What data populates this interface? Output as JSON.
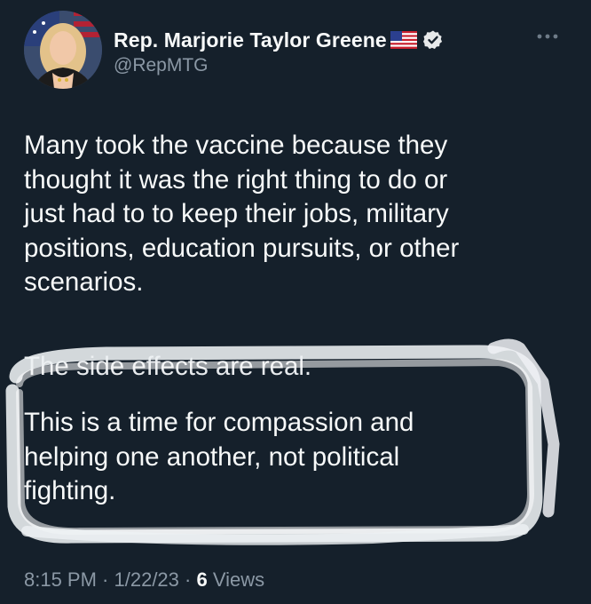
{
  "author": {
    "display_name": "Rep. Marjorie Taylor Greene",
    "flag_icon": "us-flag-icon",
    "verified_icon": "verified-badge-icon",
    "handle": "@RepMTG"
  },
  "menu": {
    "icon": "more-options-icon"
  },
  "tweet": {
    "paragraphs": [
      "Many took the vaccine because they thought it was the right thing to do or just had to to keep their jobs, military positions, education pursuits, or other scenarios.",
      "The side effects are real.",
      "This is a time for compassion and helping one another, not political fighting."
    ],
    "line_breaks": {
      "para_1": [
        "Many took the vaccine because they",
        "thought it was the right thing to do or",
        "just had to to keep their jobs, military",
        "positions, education pursuits, or other",
        "scenarios."
      ],
      "para_3": [
        "This is a time for compassion and",
        "helping one another, not political",
        "fighting."
      ]
    }
  },
  "meta": {
    "time": "8:15 PM",
    "sep1": " · ",
    "date": "1/22/23",
    "sep2": " · ",
    "views_count": "6",
    "views_label": " Views"
  },
  "colors": {
    "background": "#15202b",
    "text": "#f7f9f9",
    "secondary": "#8b98a5",
    "verified": "#e7e9ea",
    "highlight_stroke": "#eef1f4"
  }
}
